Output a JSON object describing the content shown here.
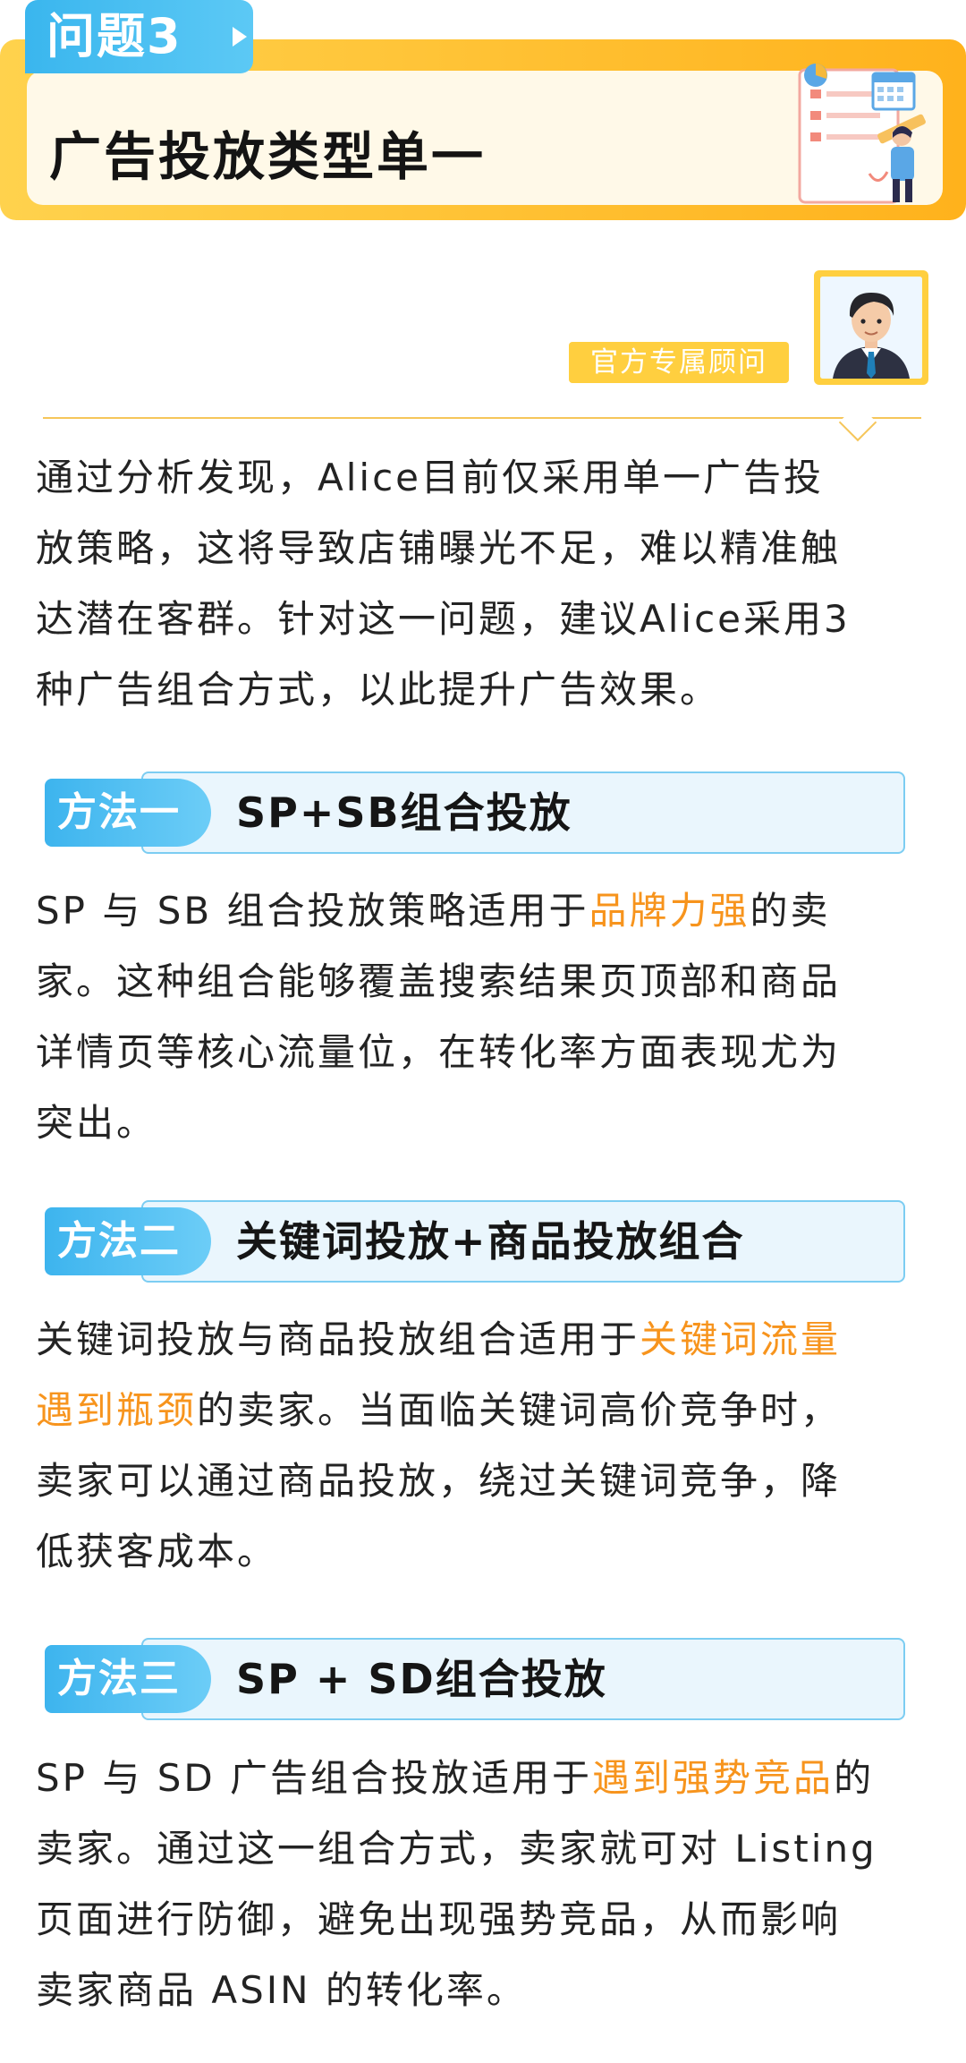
{
  "header": {
    "tab_label": "问题3",
    "title": "广告投放类型单一"
  },
  "advisor": {
    "label": "官方专属顾问"
  },
  "intro": {
    "lines": [
      "通过分析发现，Alice目前仅采用单一广告投",
      "放策略，这将导致店铺曝光不足，难以精准触",
      "达潜在客群。针对这一问题，建议Alice采用3",
      "种广告组合方式，以此提升广告效果。"
    ]
  },
  "methods": [
    {
      "tag": "方法一",
      "title": "SP+SB组合投放",
      "body": {
        "l1_a": "SP 与 SB 组合投放策略适用于",
        "l1_hl": "品牌力强",
        "l1_b": "的卖",
        "l2": "家。这种组合能够覆盖搜索结果页顶部和商品",
        "l3": "详情页等核心流量位，在转化率方面表现尤为",
        "l4": "突出。"
      }
    },
    {
      "tag": "方法二",
      "title": "关键词投放+商品投放组合",
      "body": {
        "l1_a": "关键词投放与商品投放组合适用于",
        "l1_hl": "关键词流量",
        "l2_hl": "遇到瓶颈",
        "l2_b": "的卖家。当面临关键词高价竞争时，",
        "l3": "卖家可以通过商品投放，绕过关键词竞争，降",
        "l4": "低获客成本。"
      }
    },
    {
      "tag": "方法三",
      "title": "SP + SD组合投放",
      "body": {
        "l1_a": "SP 与 SD 广告组合投放适用于",
        "l1_hl": "遇到强势竞品",
        "l1_b": "的",
        "l2": "卖家。通过这一组合方式，卖家就可对 Listing",
        "l3": "页面进行防御，避免出现强势竞品，从而影响",
        "l4": "卖家商品 ASIN 的转化率。"
      }
    }
  ],
  "colors": {
    "header_yellow": "#ffc12e",
    "tab_blue": "#3ab6ee",
    "highlight_orange": "#f7941d",
    "method_box_bg": "#eaf6fd"
  },
  "icons": [
    "play-triangle-icon",
    "document-checklist-illustration",
    "advisor-avatar"
  ]
}
